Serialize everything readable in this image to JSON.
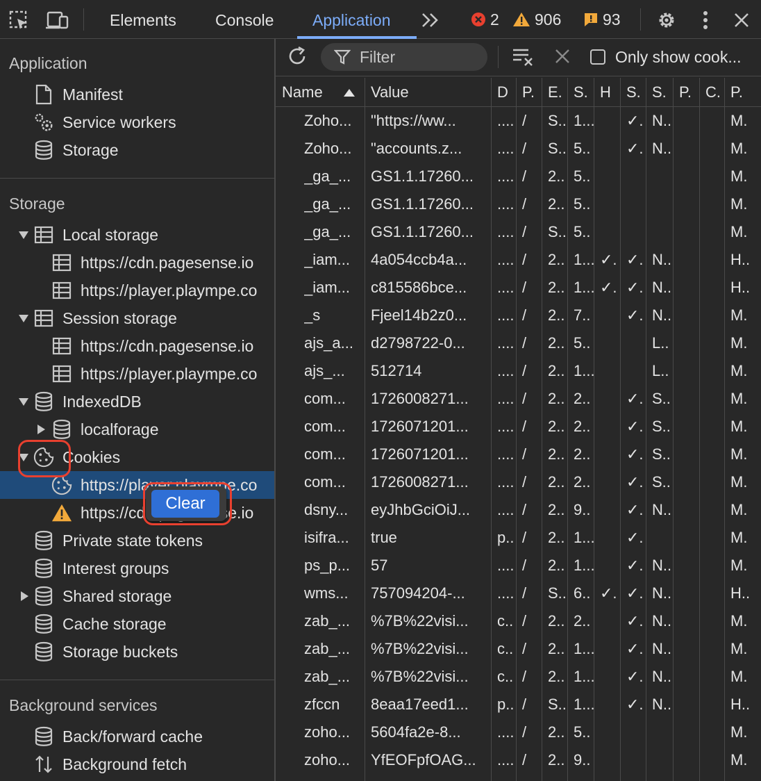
{
  "topbar": {
    "tabs": [
      {
        "label": "Elements"
      },
      {
        "label": "Console"
      },
      {
        "label": "Application"
      }
    ],
    "errors_count": "2",
    "warnings_count": "906",
    "issues_count": "93"
  },
  "sidebar": {
    "application_title": "Application",
    "application_items": [
      "Manifest",
      "Service workers",
      "Storage"
    ],
    "storage_title": "Storage",
    "local_storage": "Local storage",
    "local_children": [
      "https://cdn.pagesense.io",
      "https://player.plaympe.co"
    ],
    "session_storage": "Session storage",
    "session_children": [
      "https://cdn.pagesense.io",
      "https://player.plaympe.co"
    ],
    "indexeddb": "IndexedDB",
    "localforage": "localforage",
    "cookies": "Cookies",
    "cookie_children": [
      "https://player.plaympe.co",
      "https://cdn.pagesense.io"
    ],
    "other_storage": [
      "Private state tokens",
      "Interest groups",
      "Shared storage",
      "Cache storage",
      "Storage buckets"
    ],
    "background_title": "Background services",
    "background_items": [
      "Back/forward cache",
      "Background fetch"
    ]
  },
  "context_menu": {
    "clear_label": "Clear"
  },
  "cookie_toolbar": {
    "filter_placeholder": "Filter",
    "only_show_label": "Only show cook..."
  },
  "table": {
    "headers": [
      "Name",
      "Value",
      "D",
      "P.",
      "E.",
      "S.",
      "H",
      "S.",
      "S.",
      "P.",
      "C.",
      "P."
    ],
    "rows": [
      [
        "Zoho...",
        "\"https://ww...",
        "....",
        "/",
        "S..",
        "1...",
        "",
        "✓.",
        "N..",
        "",
        "",
        "M."
      ],
      [
        "Zoho...",
        "\"accounts.z...",
        "....",
        "/",
        "S..",
        "5..",
        "",
        "✓.",
        "N..",
        "",
        "",
        "M."
      ],
      [
        "_ga_...",
        "GS1.1.17260...",
        "....",
        "/",
        "2..",
        "5..",
        "",
        "",
        "",
        "",
        "",
        "M."
      ],
      [
        "_ga_...",
        "GS1.1.17260...",
        "....",
        "/",
        "2..",
        "5..",
        "",
        "",
        "",
        "",
        "",
        "M."
      ],
      [
        "_ga_...",
        "GS1.1.17260...",
        "....",
        "/",
        "S..",
        "5..",
        "",
        "",
        "",
        "",
        "",
        "M."
      ],
      [
        "_iam...",
        "4a054ccb4a...",
        "....",
        "/",
        "2..",
        "1...",
        "✓.",
        "✓.",
        "N..",
        "",
        "",
        "H.."
      ],
      [
        "_iam...",
        "c815586bce...",
        "....",
        "/",
        "2..",
        "1...",
        "✓.",
        "✓.",
        "N..",
        "",
        "",
        "H.."
      ],
      [
        "_s",
        "Fjeel14b2z0...",
        "....",
        "/",
        "2..",
        "7..",
        "",
        "✓.",
        "N..",
        "",
        "",
        "M."
      ],
      [
        "ajs_a...",
        "d2798722-0...",
        "....",
        "/",
        "2..",
        "5..",
        "",
        "",
        "L..",
        "",
        "",
        "M."
      ],
      [
        "ajs_...",
        "512714",
        "....",
        "/",
        "2..",
        "1...",
        "",
        "",
        "L..",
        "",
        "",
        "M."
      ],
      [
        "com...",
        "1726008271...",
        "....",
        "/",
        "2..",
        "2..",
        "",
        "✓.",
        "S..",
        "",
        "",
        "M."
      ],
      [
        "com...",
        "1726071201...",
        "....",
        "/",
        "2..",
        "2..",
        "",
        "✓.",
        "S..",
        "",
        "",
        "M."
      ],
      [
        "com...",
        "1726071201...",
        "....",
        "/",
        "2..",
        "2..",
        "",
        "✓.",
        "S..",
        "",
        "",
        "M."
      ],
      [
        "com...",
        "1726008271...",
        "....",
        "/",
        "2..",
        "2..",
        "",
        "✓.",
        "S..",
        "",
        "",
        "M."
      ],
      [
        "dsny...",
        "eyJhbGciOiJ...",
        "....",
        "/",
        "2..",
        "9..",
        "",
        "✓.",
        "N..",
        "",
        "",
        "M."
      ],
      [
        "isifra...",
        "true",
        "p..",
        "/",
        "2..",
        "1...",
        "",
        "✓.",
        "",
        "",
        "",
        "M."
      ],
      [
        "ps_p...",
        "57",
        "....",
        "/",
        "2..",
        "1...",
        "",
        "✓.",
        "N..",
        "",
        "",
        "M."
      ],
      [
        "wms...",
        "757094204-...",
        "....",
        "/",
        "S..",
        "6..",
        "✓.",
        "✓.",
        "N..",
        "",
        "",
        "H.."
      ],
      [
        "zab_...",
        "%7B%22visi...",
        "c..",
        "/",
        "2..",
        "2..",
        "",
        "✓.",
        "N..",
        "",
        "",
        "M."
      ],
      [
        "zab_...",
        "%7B%22visi...",
        "c..",
        "/",
        "2..",
        "1...",
        "",
        "✓.",
        "N..",
        "",
        "",
        "M."
      ],
      [
        "zab_...",
        "%7B%22visi...",
        "c..",
        "/",
        "2..",
        "1...",
        "",
        "✓.",
        "N..",
        "",
        "",
        "M."
      ],
      [
        "zfccn",
        "8eaa17eed1...",
        "p..",
        "/",
        "S..",
        "1...",
        "",
        "✓.",
        "N..",
        "",
        "",
        "H.."
      ],
      [
        "zoho...",
        "5604fa2e-8...",
        "....",
        "/",
        "2..",
        "5..",
        "",
        "",
        "",
        "",
        "",
        "M."
      ],
      [
        "zoho...",
        "YfEOFpfOAG...",
        "....",
        "/",
        "2..",
        "9..",
        "",
        "",
        "",
        "",
        "",
        "M."
      ]
    ]
  },
  "colors": {
    "accent": "#7cacf8",
    "selected": "#1f4b7a",
    "annotation": "#e8402f",
    "button": "#2f6fd6"
  }
}
